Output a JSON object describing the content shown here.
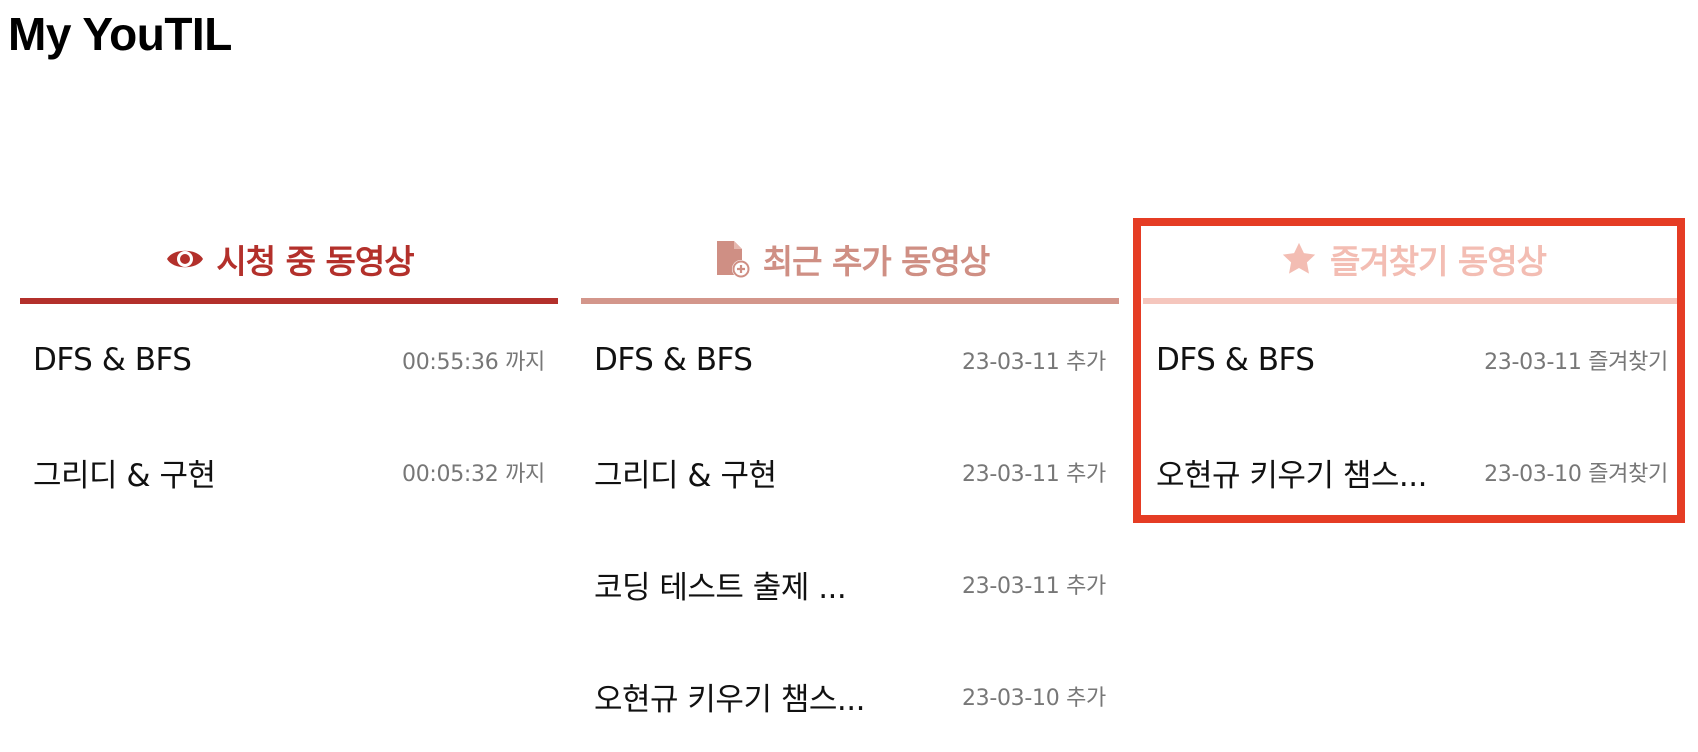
{
  "app": {
    "title": "My YouTIL"
  },
  "columns": {
    "watching": {
      "title": "시청 중 동영상",
      "icon": "eye-icon",
      "color": "#b3302b",
      "items": [
        {
          "title": "DFS & BFS",
          "meta": "00:55:36 까지"
        },
        {
          "title": "그리디 & 구현",
          "meta": "00:05:32 까지"
        }
      ]
    },
    "recent": {
      "title": "최근 추가 동영상",
      "icon": "file-plus-icon",
      "color": "#cf8f84",
      "items": [
        {
          "title": "DFS & BFS",
          "meta": "23-03-11 추가"
        },
        {
          "title": "그리디 & 구현",
          "meta": "23-03-11 추가"
        },
        {
          "title": "코딩 테스트 출제 ...",
          "meta": "23-03-11 추가"
        },
        {
          "title": "오현규 키우기 챔스...",
          "meta": "23-03-10 추가"
        }
      ]
    },
    "favorites": {
      "title": "즐겨찾기 동영상",
      "icon": "star-icon",
      "color": "#f3bdb3",
      "items": [
        {
          "title": "DFS & BFS",
          "meta": "23-03-11 즐겨찾기"
        },
        {
          "title": "오현규 키우기 챔스...",
          "meta": "23-03-10 즐겨찾기"
        }
      ]
    }
  },
  "highlight": {
    "color": "#e53c24"
  }
}
